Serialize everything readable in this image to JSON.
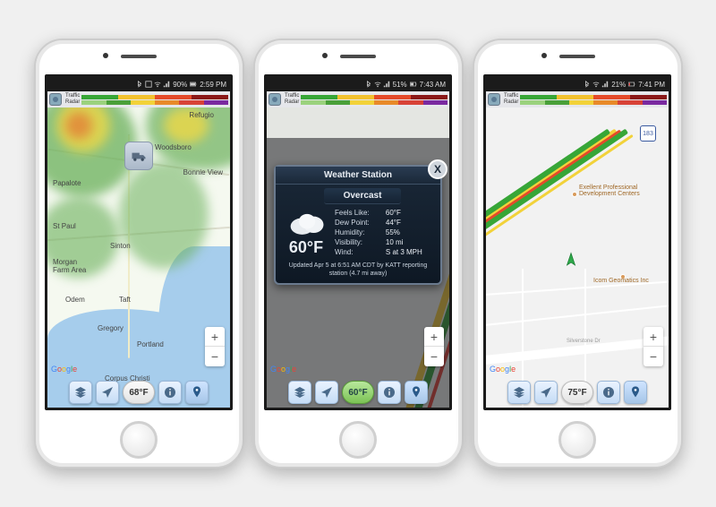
{
  "phones": [
    {
      "status": {
        "battery": "90%",
        "time": "2:59 PM"
      },
      "legend": {
        "l1": "Traffic",
        "l2": "Radar"
      },
      "map_labels": {
        "refugio": "Refugio",
        "woodsboro": "Woodsboro",
        "bonnieview": "Bonnie View",
        "papalote": "Papalote",
        "stpaul": "St Paul",
        "sinton": "Sinton",
        "morgan": "Morgan\nFarm Area",
        "odem": "Odem",
        "taft": "Taft",
        "gregory": "Gregory",
        "portland": "Portland",
        "corpus": "Corpus Christi"
      },
      "temp": "68°F",
      "zoom": {
        "in": "+",
        "out": "−"
      },
      "google": [
        "G",
        "o",
        "o",
        "g",
        "l",
        "e"
      ]
    },
    {
      "status": {
        "battery": "51%",
        "time": "7:43 AM"
      },
      "legend": {
        "l1": "Traffic",
        "l2": "Radar"
      },
      "popup": {
        "title": "Weather Station",
        "condition": "Overcast",
        "current_temp": "60°F",
        "stats": {
          "feels_like_label": "Feels Like:",
          "feels_like": "60°F",
          "dew_label": "Dew Point:",
          "dew": "44°F",
          "humidity_label": "Humidity:",
          "humidity": "55%",
          "visibility_label": "Visibility:",
          "visibility": "10 mi",
          "wind_label": "Wind:",
          "wind": "S at 3 MPH"
        },
        "footer": "Updated Apr 5 at 6:51 AM CDT by KATT reporting station (4.7 mi away)",
        "close": "X"
      },
      "temp": "60°F",
      "zoom": {
        "in": "+",
        "out": "−"
      },
      "google": [
        "G",
        "o",
        "o",
        "g",
        "l",
        "e"
      ]
    },
    {
      "status": {
        "battery": "21%",
        "time": "7:41 PM"
      },
      "legend": {
        "l1": "Traffic",
        "l2": "Radar"
      },
      "map_labels": {
        "poi1": "Exellent Professional\nDevelopment Centers",
        "poi2": "Icom Geomatics Inc",
        "street": "Silverstone Dr"
      },
      "temp": "75°F",
      "zoom": {
        "in": "+",
        "out": "−"
      },
      "google": [
        "G",
        "o",
        "o",
        "g",
        "l",
        "e"
      ]
    }
  ],
  "colors": {
    "traffic": [
      "#37a637",
      "#f2c12e",
      "#e44a2a",
      "#8a1818"
    ],
    "radar": [
      "#9bd27e",
      "#4aa03a",
      "#f2d23a",
      "#e88a2a",
      "#d84338",
      "#7a2aa0"
    ]
  }
}
